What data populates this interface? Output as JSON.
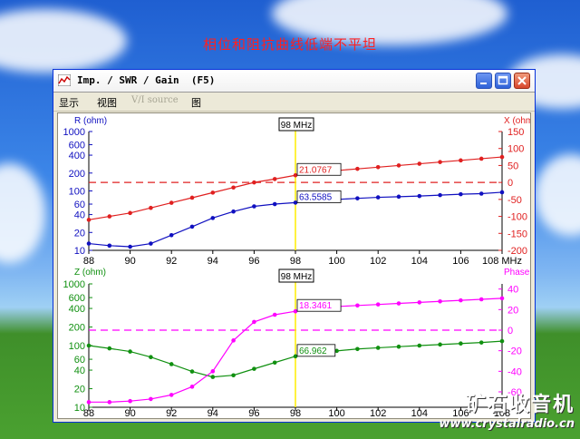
{
  "overlay_title": "相位和阻抗曲线低端不平坦",
  "window": {
    "title": "Imp. / SWR / Gain  (F5)",
    "menu": [
      "显示",
      "视图",
      "V/I source",
      "图"
    ]
  },
  "brand": {
    "name": "矿石收音机",
    "url": "www.crystalradio.cn"
  },
  "colors": {
    "red": "#e02020",
    "blue": "#1010c0",
    "green": "#109010",
    "magenta": "#ff00ff",
    "marker": "#ffee00"
  },
  "chart_data": [
    {
      "type": "line",
      "marker_label": "98 MHz",
      "left_axis_label": "R (ohm)",
      "right_axis_label": "X (ohm)",
      "x": [
        88,
        89,
        90,
        91,
        92,
        93,
        94,
        95,
        96,
        97,
        98,
        99,
        100,
        101,
        102,
        103,
        104,
        105,
        106,
        107,
        108
      ],
      "x_ticks": [
        "88",
        "90",
        "92",
        "94",
        "96",
        "98",
        "100",
        "102",
        "104",
        "106",
        "108 MHz"
      ],
      "left_ticks": [
        "1000",
        "600",
        "400",
        "200",
        "100",
        "60",
        "40",
        "20",
        "10"
      ],
      "right_ticks": [
        "150",
        "100",
        "50",
        "0",
        "-50",
        "-100",
        "-150",
        "-200"
      ],
      "left_scale": "log",
      "left_range": [
        10,
        1000
      ],
      "right_range": [
        -200,
        150
      ],
      "series": [
        {
          "name": "R",
          "axis": "left",
          "color": "#1010c0",
          "values": [
            13,
            12,
            11.5,
            13,
            18,
            25,
            35,
            45,
            55,
            60,
            63.5585,
            70,
            72,
            75,
            78,
            80,
            82,
            85,
            88,
            90,
            95
          ]
        },
        {
          "name": "X",
          "axis": "right",
          "color": "#e02020",
          "values": [
            -110,
            -100,
            -90,
            -75,
            -60,
            -45,
            -30,
            -15,
            0,
            10,
            21.0767,
            30,
            35,
            40,
            45,
            50,
            55,
            60,
            65,
            70,
            75
          ]
        }
      ],
      "readouts": {
        "R": "63.5585",
        "X": "21.0767"
      },
      "reference_line": {
        "axis": "right",
        "value": 0,
        "color": "#e02020"
      }
    },
    {
      "type": "line",
      "marker_label": "98 MHz",
      "left_axis_label": "Z (ohm)",
      "right_axis_label": "Phase",
      "x": [
        88,
        89,
        90,
        91,
        92,
        93,
        94,
        95,
        96,
        97,
        98,
        99,
        100,
        101,
        102,
        103,
        104,
        105,
        106,
        107,
        108
      ],
      "x_ticks": [
        "88",
        "90",
        "92",
        "94",
        "96",
        "98",
        "100",
        "102",
        "104",
        "106",
        "108"
      ],
      "left_ticks": [
        "1000",
        "600",
        "400",
        "200",
        "100",
        "60",
        "40",
        "20",
        "10"
      ],
      "right_ticks": [
        "40",
        "20",
        "0",
        "-20",
        "-40",
        "-60"
      ],
      "left_scale": "log",
      "left_range": [
        10,
        1000
      ],
      "right_range": [
        -75,
        45
      ],
      "series": [
        {
          "name": "Z",
          "axis": "left",
          "color": "#109010",
          "values": [
            100,
            90,
            80,
            65,
            50,
            38,
            31,
            33,
            42,
            53,
            66.962,
            75,
            82,
            88,
            92,
            96,
            100,
            104,
            108,
            112,
            118
          ]
        },
        {
          "name": "Phase",
          "axis": "right",
          "color": "#ff00ff",
          "values": [
            -70,
            -70,
            -69,
            -67,
            -63,
            -55,
            -40,
            -10,
            8,
            15,
            18.3461,
            21,
            23,
            24,
            25,
            26,
            27,
            28,
            29,
            30,
            31
          ]
        }
      ],
      "readouts": {
        "Z": "66.962",
        "Phase": "18.3461"
      },
      "reference_line": {
        "axis": "right",
        "value": 0,
        "color": "#ff00ff"
      }
    }
  ]
}
